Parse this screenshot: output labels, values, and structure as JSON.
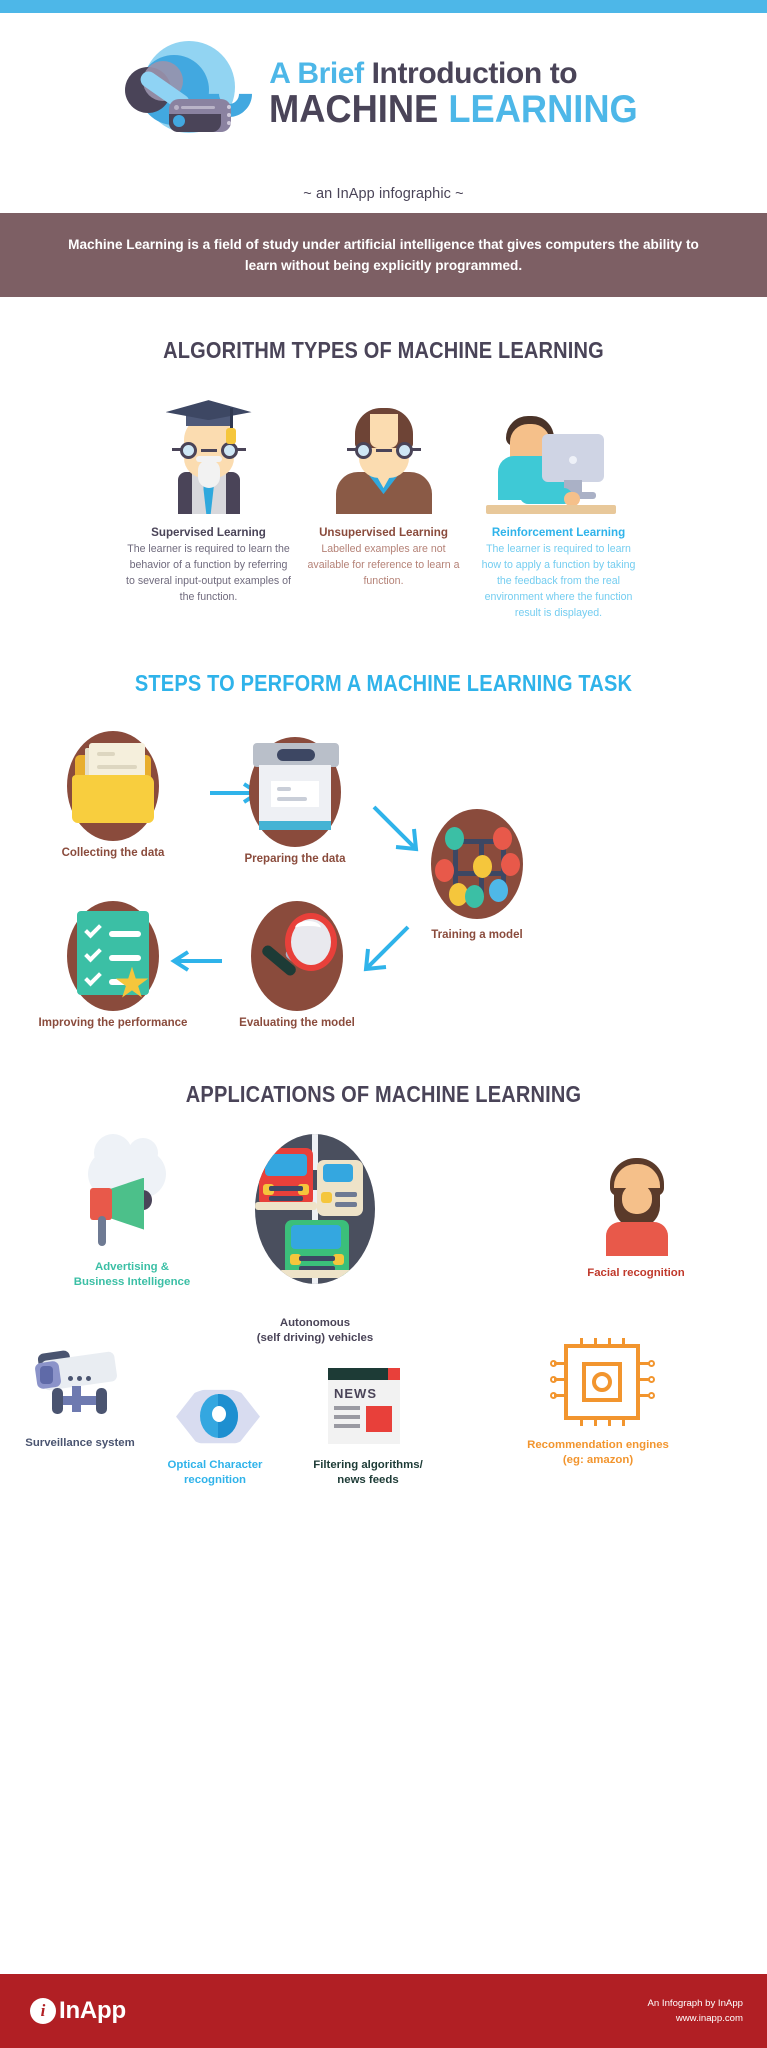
{
  "theme": {
    "accent_blue": "#4db7e8",
    "dark_purple": "#4a4458",
    "mauve": "#7d5f64",
    "brown": "#8a4b3c",
    "teal": "#3bbfa5",
    "red": "#e8403a",
    "orange": "#f2952e",
    "footer_red": "#b11f24"
  },
  "hero": {
    "icon_name": "machine-learning-robot-icon",
    "title_line1_accent": "A Brief",
    "title_line1_rest": " Introduction to",
    "title_line2_dark": "MACHINE ",
    "title_line2_accent": "LEARNING",
    "subtitle": "~ an InApp infographic ~"
  },
  "definition": {
    "text": "Machine Learning is a field of study under artificial intelligence that gives computers the ability to learn without being explicitly programmed."
  },
  "algorithm_section": {
    "heading": "ALGORITHM TYPES OF MACHINE LEARNING",
    "types": [
      {
        "title": "Supervised Learning",
        "desc": "The learner is required to learn the behavior of a function by referring to several input-output examples of the function.",
        "icon_name": "graduate-professor-icon",
        "color": "#4a4458"
      },
      {
        "title": "Unsupervised Learning",
        "desc": "Labelled examples are not available for reference to learn a function.",
        "icon_name": "student-person-icon",
        "color": "#8a4b3c"
      },
      {
        "title": "Reinforcement Learning",
        "desc": "The learner is required to learn how to apply a function by taking the feedback from the real environment where the function result is displayed.",
        "icon_name": "person-at-computer-icon",
        "color": "#2fb3ea"
      }
    ]
  },
  "steps_section": {
    "heading": "STEPS TO PERFORM A MACHINE LEARNING TASK",
    "steps": [
      {
        "label": "Collecting the data",
        "icon_name": "folder-documents-icon"
      },
      {
        "label": "Preparing the data",
        "icon_name": "printer-scanner-icon"
      },
      {
        "label": "Training a model",
        "icon_name": "neural-network-nodes-icon"
      },
      {
        "label": "Evaluating the model",
        "icon_name": "magnifying-glass-icon"
      },
      {
        "label": "Improving the performance",
        "icon_name": "checklist-star-icon"
      }
    ]
  },
  "applications_section": {
    "heading": "APPLICATIONS OF MACHINE LEARNING",
    "applications": [
      {
        "label": "Advertising &\nBusiness Intelligence",
        "line1": "Advertising &",
        "line2": "Business Intelligence",
        "icon_name": "megaphone-cloud-icon",
        "color": "#3bbfa5"
      },
      {
        "label": "Autonomous\n(self driving) vehicles",
        "line1": "Autonomous",
        "line2": "(self driving) vehicles",
        "icon_name": "self-driving-cars-icon",
        "color": "#4a4458"
      },
      {
        "label": "Facial recognition",
        "line1": "Facial recognition",
        "line2": "",
        "icon_name": "bearded-face-icon",
        "color": "#c0392b"
      },
      {
        "label": "Surveillance system",
        "line1": "Surveillance system",
        "line2": "",
        "icon_name": "security-camera-icon",
        "color": "#4a5470"
      },
      {
        "label": "Optical Character\nrecognition",
        "line1": "Optical Character",
        "line2": "recognition",
        "icon_name": "eye-scan-icon",
        "color": "#2fb3ea"
      },
      {
        "label": "Filtering algorithms/\nnews feeds",
        "line1": "Filtering algorithms/",
        "line2": "news feeds",
        "icon_name": "newspaper-icon",
        "color": "#1d3b36"
      },
      {
        "label": "Recommendation engines\n(eg: amazon)",
        "line1": "Recommendation engines",
        "line2": "(eg: amazon)",
        "icon_name": "circuit-chip-icon",
        "color": "#f2952e"
      }
    ]
  },
  "footer": {
    "logo_mark": "i",
    "logo_text": "InApp",
    "credit_line1": "An Infograph by InApp",
    "credit_line2": "www.inapp.com"
  }
}
